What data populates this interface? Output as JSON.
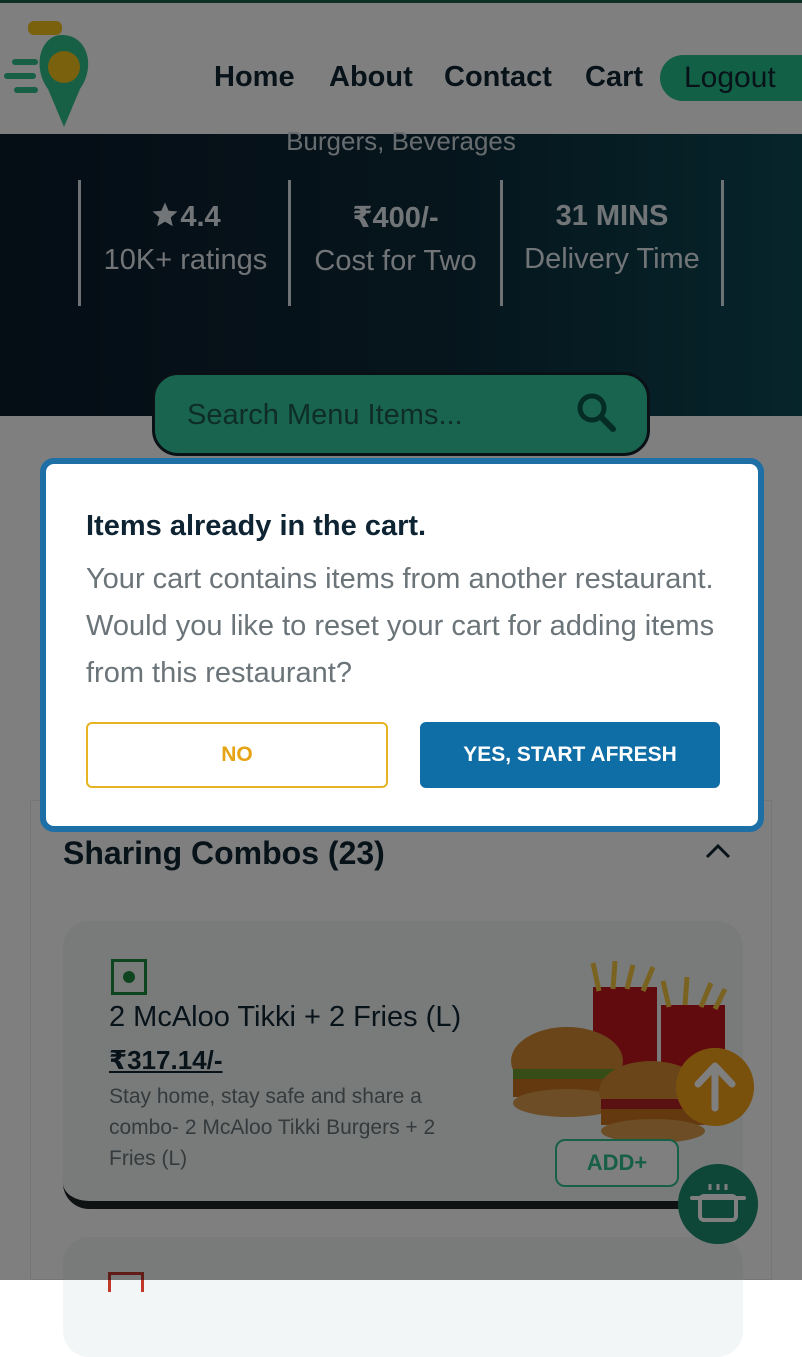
{
  "header": {
    "nav": [
      "Home",
      "About",
      "Contact",
      "Cart"
    ],
    "logout_label": "Logout"
  },
  "restaurant": {
    "cuisines": "Burgers, Beverages",
    "rating": "4.4",
    "ratings_count": "10K+ ratings",
    "cost": "₹400/-",
    "cost_label": "Cost for Two",
    "delivery": "31 MINS",
    "delivery_label": "Delivery Time"
  },
  "search": {
    "placeholder": "Search Menu Items..."
  },
  "menu": {
    "section_title": "Sharing Combos (23)",
    "items": [
      {
        "name": "2 McAloo Tikki + 2 Fries (L)",
        "price": "₹317.14/-",
        "description": "Stay home, stay safe and share a combo- 2 McAloo Tikki Burgers + 2 Fries (L)",
        "add_label": "ADD+"
      }
    ]
  },
  "modal": {
    "title": "Items already in the cart.",
    "message": "Your cart contains items from another restaurant. Would you like to reset your cart for adding items from this restaurant?",
    "no_label": "NO",
    "yes_label": "YES, START AFRESH"
  },
  "colors": {
    "brand_green": "#25c08a",
    "modal_blue": "#0f6ea6",
    "accent_yellow": "#e6b422"
  },
  "icons": [
    "logo-icon",
    "star-icon",
    "search-icon",
    "chevron-up-icon",
    "veg-icon",
    "arrow-up-icon",
    "cart-pot-icon"
  ]
}
